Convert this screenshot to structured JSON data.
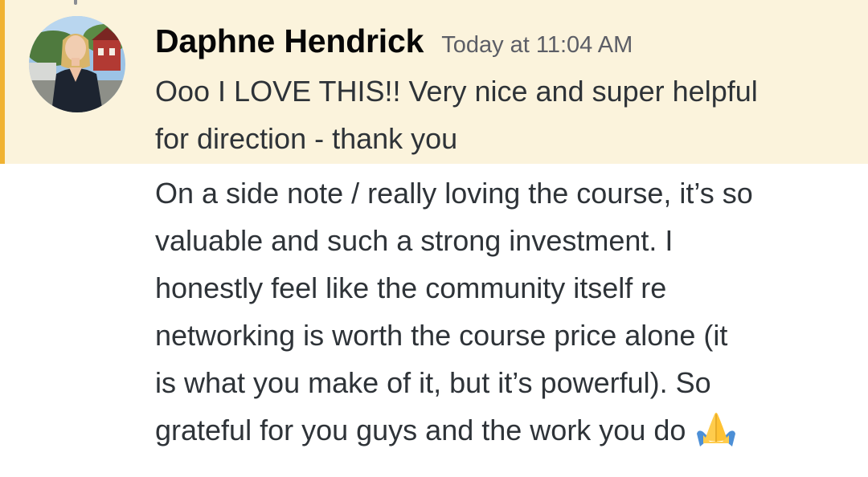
{
  "message": {
    "author": "Daphne Hendrick",
    "timestamp": "Today at 11:04 AM",
    "highlighted": true,
    "highlight_color": "#fbf3dc",
    "highlight_bar_color": "#f0b232",
    "avatar": "profile-photo",
    "first_paragraph_lines": [
      "Ooo I LOVE THIS!! Very nice and super helpful",
      "for direction - thank you"
    ],
    "second_paragraph_lines": [
      "On a side note / really loving the course, it’s so",
      "valuable and such a strong investment. I",
      "honestly feel like the community itself re",
      "networking is worth the course price alone (it",
      "is what you make of it, but it’s powerful). So",
      "grateful for you guys and the work you do"
    ],
    "trailing_emoji": "folded-hands-emoji"
  }
}
